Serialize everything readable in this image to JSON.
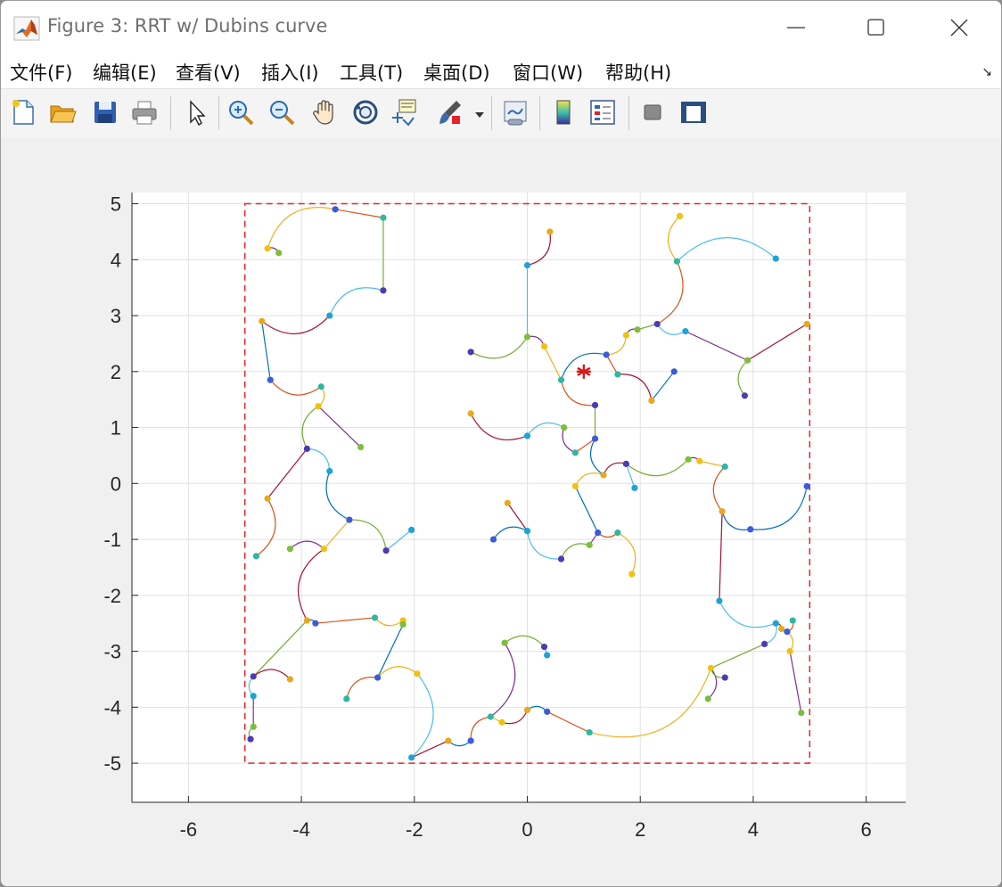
{
  "window": {
    "title": "Figure 3: RRT w/ Dubins curve",
    "controls": {
      "minimize": "minimize",
      "maximize": "maximize",
      "close": "close"
    }
  },
  "menu": [
    {
      "label": "文件(F)"
    },
    {
      "label": "编辑(E)"
    },
    {
      "label": "查看(V)"
    },
    {
      "label": "插入(I)"
    },
    {
      "label": "工具(T)"
    },
    {
      "label": "桌面(D)"
    },
    {
      "label": "窗口(W)"
    },
    {
      "label": "帮助(H)"
    }
  ],
  "menu_overflow_icon": "dock-arrow-icon",
  "toolbar": [
    {
      "name": "new-figure",
      "icon": "new-file-icon"
    },
    {
      "name": "open-file",
      "icon": "folder-open-icon"
    },
    {
      "name": "save-figure",
      "icon": "save-icon"
    },
    {
      "name": "print-figure",
      "icon": "printer-icon"
    },
    {
      "name": "edit-plot",
      "icon": "pointer-icon"
    },
    {
      "name": "zoom-in",
      "icon": "zoom-in-icon"
    },
    {
      "name": "zoom-out",
      "icon": "zoom-out-icon"
    },
    {
      "name": "pan",
      "icon": "hand-icon"
    },
    {
      "name": "rotate-3d",
      "icon": "rotate-icon"
    },
    {
      "name": "data-cursor",
      "icon": "data-cursor-icon"
    },
    {
      "name": "brush",
      "icon": "brush-icon"
    },
    {
      "name": "brush-menu",
      "icon": "dropdown-arrow-icon"
    },
    {
      "name": "link-plot",
      "icon": "link-plot-icon"
    },
    {
      "name": "insert-colorbar",
      "icon": "colorbar-icon"
    },
    {
      "name": "insert-legend",
      "icon": "legend-icon"
    },
    {
      "name": "hide-plot-tools",
      "icon": "hide-tools-icon"
    },
    {
      "name": "show-plot-tools",
      "icon": "show-tools-icon"
    }
  ],
  "colors": {
    "boundary": "#e8222a",
    "goal_marker": "#d7191c",
    "plot_bg": "#ffffff",
    "grid": "#e2e2e2",
    "palette": [
      "#0072bd",
      "#d95319",
      "#edb120",
      "#7e2f8e",
      "#77ac30",
      "#4dbeee",
      "#a2142f"
    ]
  },
  "chart_data": {
    "type": "scatter",
    "title": "",
    "xlabel": "",
    "ylabel": "",
    "xlim": [
      -7,
      6.7
    ],
    "ylim": [
      -5.7,
      5.2
    ],
    "xticks": [
      "-6",
      "-4",
      "-2",
      "0",
      "2",
      "4",
      "6"
    ],
    "yticks": [
      "-5",
      "-4",
      "-3",
      "-2",
      "-1",
      "0",
      "1",
      "2",
      "3",
      "4",
      "5"
    ],
    "grid": true,
    "boundary": {
      "x": [
        -5,
        5
      ],
      "y": [
        -5,
        5
      ],
      "style": "dashed"
    },
    "goal": {
      "x": 1.0,
      "y": 2.0,
      "marker": "asterisk"
    },
    "nodes": [
      [
        -3.4,
        4.9
      ],
      [
        -2.55,
        4.75
      ],
      [
        -4.6,
        4.2
      ],
      [
        -4.4,
        4.12
      ],
      [
        -2.55,
        3.45
      ],
      [
        -3.5,
        3.0
      ],
      [
        -4.7,
        2.9
      ],
      [
        -4.55,
        1.85
      ],
      [
        -3.65,
        1.73
      ],
      [
        -3.7,
        1.38
      ],
      [
        -2.95,
        0.65
      ],
      [
        -3.9,
        0.62
      ],
      [
        -3.5,
        0.22
      ],
      [
        -4.6,
        -0.27
      ],
      [
        -3.15,
        -0.65
      ],
      [
        -4.8,
        -1.3
      ],
      [
        -3.6,
        -1.17
      ],
      [
        -4.2,
        -1.17
      ],
      [
        -2.5,
        -1.2
      ],
      [
        -2.05,
        -0.83
      ],
      [
        -3.9,
        -2.45
      ],
      [
        -3.75,
        -2.5
      ],
      [
        -2.7,
        -2.4
      ],
      [
        -2.2,
        -2.45
      ],
      [
        -2.2,
        -2.52
      ],
      [
        -4.85,
        -3.45
      ],
      [
        -4.85,
        -3.8
      ],
      [
        -4.2,
        -3.5
      ],
      [
        -2.65,
        -3.47
      ],
      [
        -3.2,
        -3.85
      ],
      [
        -1.95,
        -3.4
      ],
      [
        -4.85,
        -4.35
      ],
      [
        -4.9,
        -4.57
      ],
      [
        -2.05,
        -4.9
      ],
      [
        -1.4,
        -4.6
      ],
      [
        -1.0,
        -4.6
      ],
      [
        -0.65,
        -4.17
      ],
      [
        -0.45,
        -4.27
      ],
      [
        -0.4,
        -2.85
      ],
      [
        0.3,
        -2.92
      ],
      [
        0.35,
        -3.07
      ],
      [
        0.0,
        -4.05
      ],
      [
        0.35,
        -4.08
      ],
      [
        1.1,
        -4.45
      ],
      [
        3.25,
        -3.3
      ],
      [
        3.2,
        -3.85
      ],
      [
        4.2,
        -2.87
      ],
      [
        4.4,
        -2.5
      ],
      [
        4.5,
        -2.6
      ],
      [
        4.6,
        -2.65
      ],
      [
        4.7,
        -2.45
      ],
      [
        4.65,
        -3.0
      ],
      [
        4.85,
        -4.1
      ],
      [
        3.5,
        -3.47
      ],
      [
        3.4,
        -2.1
      ],
      [
        3.45,
        -0.5
      ],
      [
        3.95,
        -0.82
      ],
      [
        3.5,
        0.3
      ],
      [
        3.05,
        0.4
      ],
      [
        2.85,
        0.43
      ],
      [
        1.75,
        0.35
      ],
      [
        1.9,
        -0.08
      ],
      [
        1.35,
        0.15
      ],
      [
        1.2,
        0.8
      ],
      [
        0.85,
        0.55
      ],
      [
        0.85,
        -0.05
      ],
      [
        0.65,
        1.0
      ],
      [
        1.2,
        1.4
      ],
      [
        0.0,
        0.85
      ],
      [
        -1.0,
        1.25
      ],
      [
        1.25,
        -0.88
      ],
      [
        1.6,
        -0.88
      ],
      [
        1.85,
        -1.62
      ],
      [
        1.1,
        -1.1
      ],
      [
        0.6,
        -1.35
      ],
      [
        0.0,
        -0.85
      ],
      [
        -0.35,
        -0.35
      ],
      [
        -0.6,
        -1.0
      ],
      [
        0.6,
        1.85
      ],
      [
        0.3,
        2.45
      ],
      [
        0.0,
        2.62
      ],
      [
        -1.0,
        2.35
      ],
      [
        0.0,
        3.9
      ],
      [
        0.4,
        4.5
      ],
      [
        1.4,
        2.3
      ],
      [
        1.6,
        1.95
      ],
      [
        1.75,
        2.65
      ],
      [
        1.95,
        2.75
      ],
      [
        2.3,
        2.85
      ],
      [
        2.8,
        2.72
      ],
      [
        2.2,
        1.48
      ],
      [
        2.6,
        2.0
      ],
      [
        2.65,
        3.97
      ],
      [
        2.7,
        4.78
      ],
      [
        3.9,
        2.2
      ],
      [
        3.85,
        1.57
      ],
      [
        4.4,
        4.02
      ],
      [
        4.95,
        2.85
      ],
      [
        4.95,
        -0.05
      ]
    ]
  }
}
